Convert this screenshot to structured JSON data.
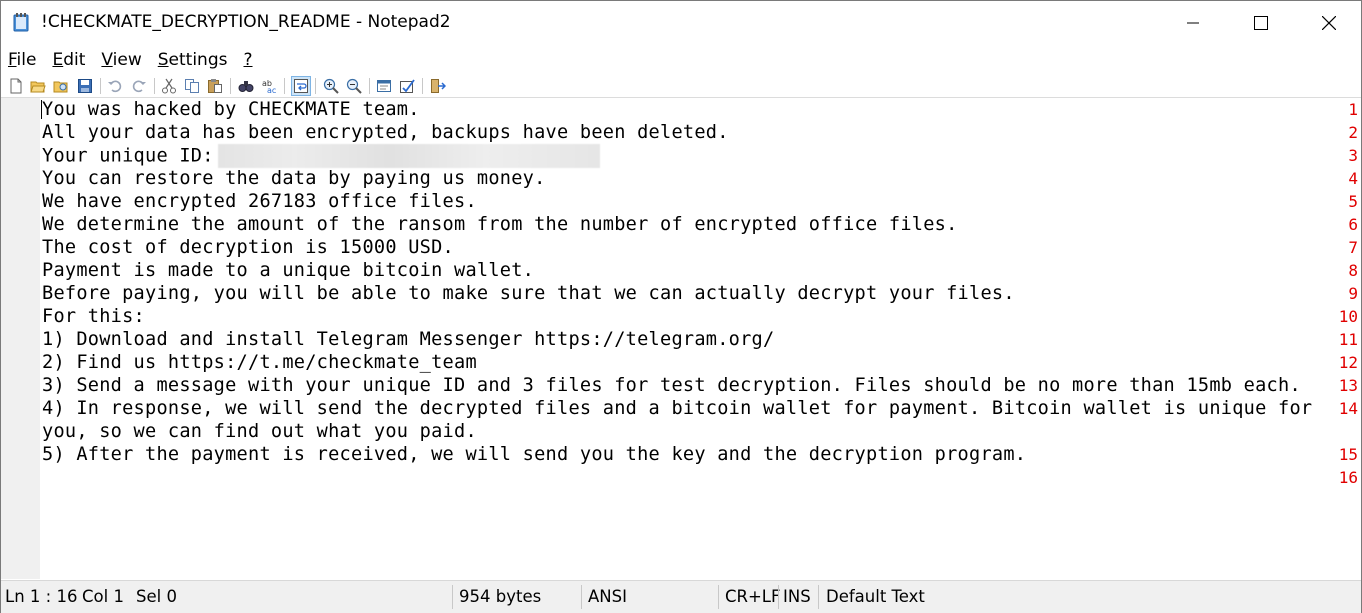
{
  "window": {
    "title": "!CHECKMATE_DECRYPTION_README - Notepad2"
  },
  "menu": {
    "file": {
      "mnemonic": "F",
      "rest": "ile"
    },
    "edit": {
      "mnemonic": "E",
      "rest": "dit"
    },
    "view": {
      "mnemonic": "V",
      "rest": "iew"
    },
    "settings": {
      "mnemonic": "S",
      "rest": "ettings"
    },
    "help": {
      "mnemonic": "?",
      "rest": ""
    }
  },
  "toolbar": {
    "icons": [
      "new-icon",
      "open-icon",
      "browse-icon",
      "save-icon",
      "undo-icon",
      "redo-icon",
      "cut-icon",
      "copy-icon",
      "paste-icon",
      "find-icon",
      "replace-icon",
      "word-wrap-icon",
      "zoom-in-icon",
      "zoom-out-icon",
      "scheme-icon",
      "customize-schemes-icon",
      "exit-icon"
    ]
  },
  "editor": {
    "lines": [
      {
        "num": "1",
        "text": "You was hacked by CHECKMATE team."
      },
      {
        "num": "2",
        "text": "All your data has been encrypted, backups have been deleted."
      },
      {
        "num": "3",
        "text": "Your unique ID:"
      },
      {
        "num": "4",
        "text": "You can restore the data by paying us money."
      },
      {
        "num": "5",
        "text": "We have encrypted 267183 office files."
      },
      {
        "num": "6",
        "text": "We determine the amount of the ransom from the number of encrypted office files."
      },
      {
        "num": "7",
        "text": "The cost of decryption is 15000 USD."
      },
      {
        "num": "8",
        "text": "Payment is made to a unique bitcoin wallet."
      },
      {
        "num": "9",
        "text": "Before paying, you will be able to make sure that we can actually decrypt your files."
      },
      {
        "num": "10",
        "text": "For this:"
      },
      {
        "num": "11",
        "text": "1) Download and install Telegram Messenger https://telegram.org/"
      },
      {
        "num": "12",
        "text": "2) Find us https://t.me/checkmate_team"
      },
      {
        "num": "13",
        "text": "3) Send a message with your unique ID and 3 files for test decryption. Files should be no more than 15mb each."
      },
      {
        "num": "14",
        "text": "4) In response, we will send the decrypted files and a bitcoin wallet for payment. Bitcoin wallet is unique for"
      },
      {
        "num": "",
        "text": "you, so we can find out what you paid."
      },
      {
        "num": "15",
        "text": "5) After the payment is received, we will send you the key and the decryption program."
      },
      {
        "num": "16",
        "text": ""
      }
    ]
  },
  "status": {
    "position": "Ln 1 : 16",
    "column": "Col 1",
    "selection": "Sel 0",
    "size": "954 bytes",
    "encoding": "ANSI",
    "line_endings": "CR+LF",
    "insert_mode": "INS",
    "scheme": "Default Text"
  }
}
